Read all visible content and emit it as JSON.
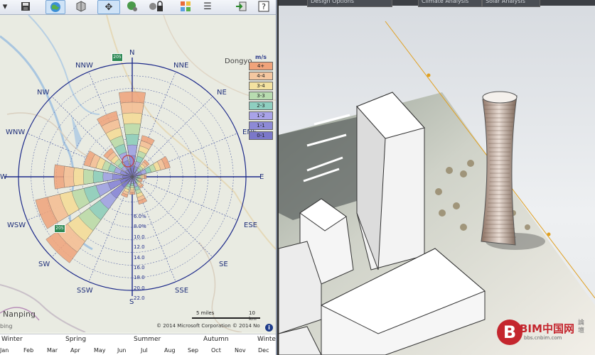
{
  "toolbar": {
    "buttons": [
      {
        "icon": "dropdown-arrow-icon"
      },
      {
        "icon": "save-icon"
      },
      {
        "icon": "globe-icon"
      },
      {
        "icon": "box-3d-icon"
      },
      {
        "icon": "move-arrows-icon"
      },
      {
        "icon": "globe-settings-icon"
      },
      {
        "icon": "lock-settings-icon"
      },
      {
        "icon": "grid-view-icon"
      },
      {
        "icon": "list-view-icon"
      },
      {
        "icon": "export-icon"
      },
      {
        "icon": "help-icon"
      }
    ]
  },
  "tabs": [
    "Design Options",
    "Climate Analysis",
    "Solar Analysis"
  ],
  "compass": {
    "N": "N",
    "NNE": "NNE",
    "NE": "NE",
    "ENE": "ENE",
    "E": "E",
    "ESE": "ESE",
    "SE": "SE",
    "SSE": "SSE",
    "S": "S",
    "SSW": "SSW",
    "SW": "SW",
    "WSW": "WSW",
    "W": "W",
    "WNW": "WNW",
    "NW": "NW",
    "NNW": "NNW"
  },
  "places": {
    "dongyo": "Dongyo",
    "nanping": "Nanping"
  },
  "road_shields": [
    "205",
    "205"
  ],
  "ring_labels": [
    "6.0%",
    "8.0%",
    "10.0",
    "12.0",
    "14.0",
    "16.0",
    "18.0",
    "20.0",
    "22.0"
  ],
  "legend": {
    "unit": "m/s",
    "bins": [
      {
        "label": "4+",
        "color": "#f0a37a"
      },
      {
        "label": "4-4",
        "color": "#f4c7a0"
      },
      {
        "label": "3-4",
        "color": "#f3e2a0"
      },
      {
        "label": "3-3",
        "color": "#b8dcb0"
      },
      {
        "label": "2-3",
        "color": "#8fcfc0"
      },
      {
        "label": "1-2",
        "color": "#a9a3e8"
      },
      {
        "label": "1-1",
        "color": "#8d8ad6"
      },
      {
        "label": "0-1",
        "color": "#7b78c9"
      }
    ]
  },
  "scale": {
    "miles": "5 miles",
    "km": "10 km"
  },
  "copyright": "© 2014 Microsoft Corporation   © 2014 No",
  "bing": "bing",
  "timeline": {
    "seasons": [
      "Winter",
      "Spring",
      "Summer",
      "Autumn",
      "Winter"
    ],
    "months": [
      "Jan",
      "Feb",
      "Mar",
      "Apr",
      "May",
      "Jun",
      "Jul",
      "Aug",
      "Sep",
      "Oct",
      "Nov",
      "Dec"
    ]
  },
  "watermark": {
    "cn": "BIM中国网",
    "sub": "bbs.cnbim.com",
    "side": "論壇"
  }
}
